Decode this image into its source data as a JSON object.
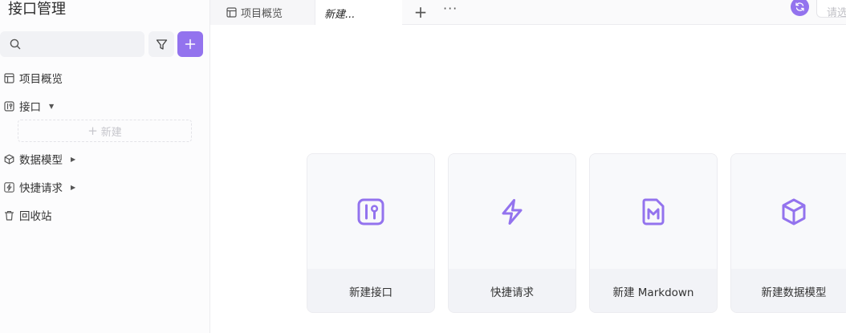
{
  "sidebar": {
    "title": "接口管理",
    "search": {
      "placeholder": ""
    },
    "items": [
      {
        "label": "项目概览",
        "icon": "layout-icon"
      },
      {
        "label": "接口",
        "icon": "api-icon",
        "expanded": true
      },
      {
        "label": "数据模型",
        "icon": "cube-icon",
        "expanded": false
      },
      {
        "label": "快捷请求",
        "icon": "bolt-icon",
        "expanded": false
      },
      {
        "label": "回收站",
        "icon": "trash-icon"
      }
    ],
    "new_label": "新建"
  },
  "tabs": [
    {
      "label": "项目概览",
      "icon": "layout-icon",
      "active": false
    },
    {
      "label": "新建...",
      "active": true
    }
  ],
  "header": {
    "env_placeholder": "请选"
  },
  "cards": [
    {
      "label": "新建接口",
      "icon": "api-icon"
    },
    {
      "label": "快捷请求",
      "icon": "bolt-icon"
    },
    {
      "label": "新建 Markdown",
      "icon": "markdown-icon"
    },
    {
      "label": "新建数据模型",
      "icon": "cube-icon"
    }
  ],
  "colors": {
    "accent": "#9373ee",
    "card_bg": "#f7f8fa",
    "card_label_bg": "#f2f3f7"
  }
}
